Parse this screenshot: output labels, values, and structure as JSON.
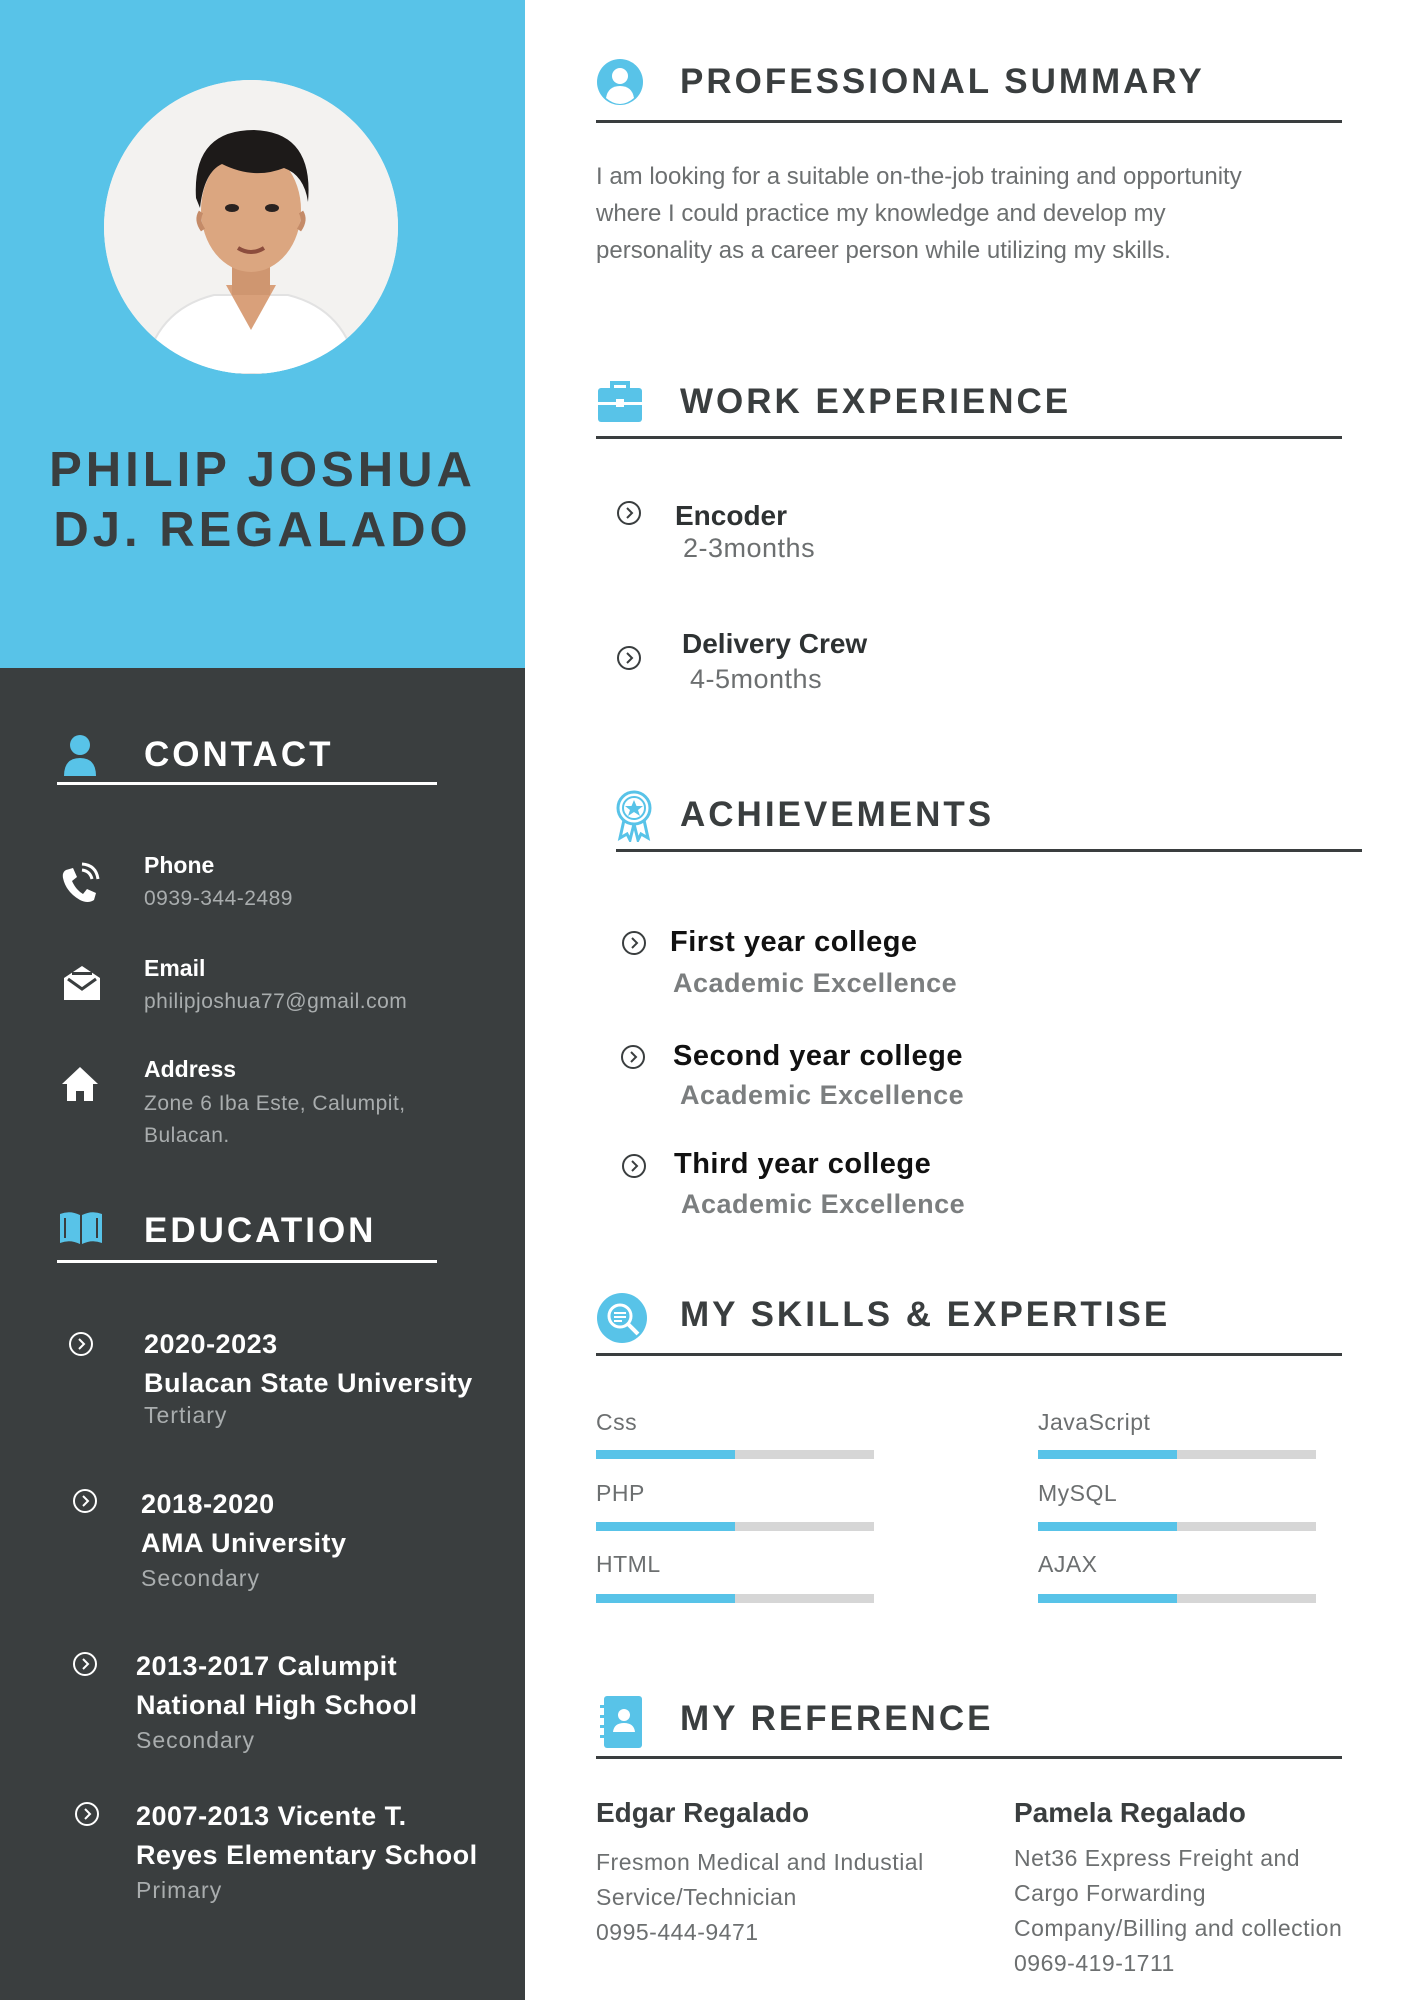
{
  "profile": {
    "name_line1": "PHILIP JOSHUA",
    "name_line2": "DJ. REGALADO"
  },
  "contact": {
    "heading": "CONTACT",
    "phone_label": "Phone",
    "phone_value": "0939-344-2489",
    "email_label": "Email",
    "email_value": "philipjoshua77@gmail.com",
    "address_label": "Address",
    "address_line1": "Zone 6 Iba Este, Calumpit,",
    "address_line2": "Bulacan."
  },
  "education": {
    "heading": "EDUCATION",
    "items": [
      {
        "line1": "2020-2023",
        "line2": "Bulacan State University",
        "level": "Tertiary"
      },
      {
        "line1": "2018-2020",
        "line2": "AMA University",
        "level": "Secondary"
      },
      {
        "line1": "2013-2017  Calumpit",
        "line2": "National High School",
        "level": "Secondary"
      },
      {
        "line1": "2007-2013 Vicente T.",
        "line2": "Reyes Elementary School",
        "level": "Primary"
      }
    ]
  },
  "summary": {
    "heading": "PROFESSIONAL SUMMARY",
    "line1": "I am looking for a suitable on-the-job training and opportunity",
    "line2": "where I could practice my knowledge and develop my",
    "line3": "personality as a career person while utilizing my skills."
  },
  "work": {
    "heading": "WORK EXPERIENCE",
    "items": [
      {
        "title": "Encoder",
        "duration": "2-3months"
      },
      {
        "title": "Delivery Crew",
        "duration": "4-5months"
      }
    ]
  },
  "achievements": {
    "heading": "ACHIEVEMENTS",
    "items": [
      {
        "title": "First year college",
        "sub": "Academic Excellence"
      },
      {
        "title": "Second year college",
        "sub": "Academic Excellence"
      },
      {
        "title": "Third year college",
        "sub": "Academic Excellence"
      }
    ]
  },
  "skills": {
    "heading": "MY SKILLS & EXPERTISE",
    "items": [
      {
        "name": "Css",
        "level": 0.5
      },
      {
        "name": "JavaScript",
        "level": 0.5
      },
      {
        "name": "PHP",
        "level": 0.5
      },
      {
        "name": "MySQL",
        "level": 0.5
      },
      {
        "name": "HTML",
        "level": 0.5
      },
      {
        "name": "AJAX",
        "level": 0.5
      }
    ]
  },
  "references": {
    "heading": "MY REFERENCE",
    "items": [
      {
        "name": "Edgar Regalado",
        "lines": [
          "Fresmon Medical and Industial",
          "Service/Technician",
          "0995-444-9471"
        ]
      },
      {
        "name": "Pamela Regalado",
        "lines": [
          "Net36 Express Freight and",
          "Cargo Forwarding",
          "Company/Billing and collection",
          "0969-419-1711"
        ]
      }
    ]
  },
  "colors": {
    "accent": "#58c3e8",
    "dark": "#3a3e3f",
    "track": "#d6d6d6"
  },
  "icons": [
    "user-icon",
    "briefcase-icon",
    "award-icon",
    "skills-icon",
    "contact-book-icon",
    "phone-icon",
    "envelope-icon",
    "home-icon",
    "open-book-icon",
    "chevron-circle-icon"
  ]
}
